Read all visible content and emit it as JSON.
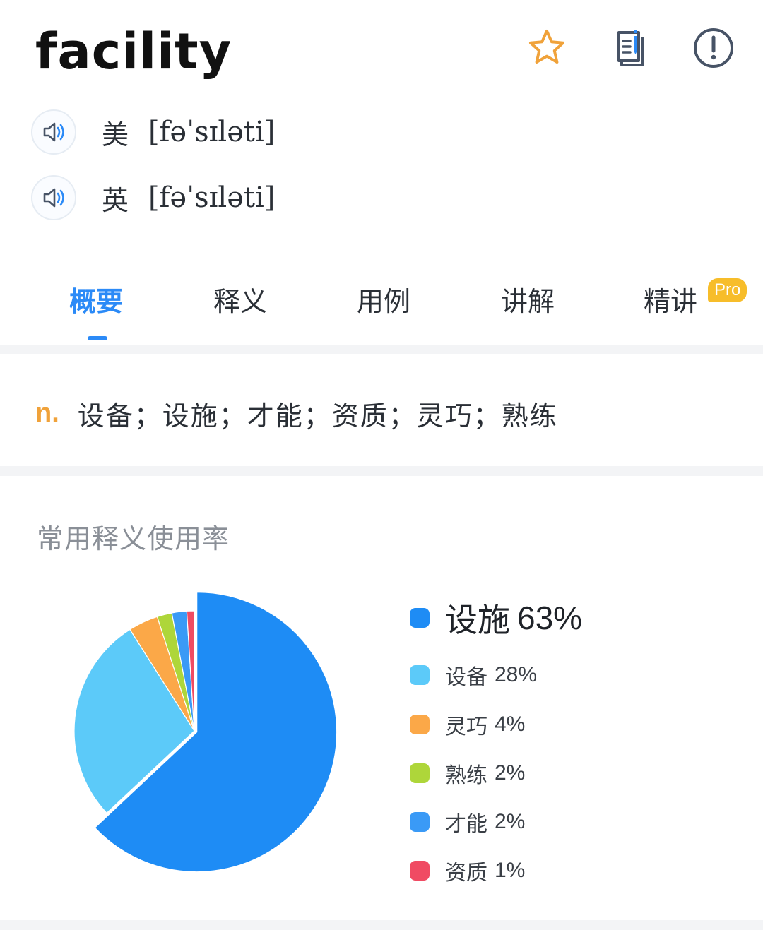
{
  "header": {
    "word": "facility",
    "icons": [
      {
        "name": "star-icon",
        "color": "#f0a23a"
      },
      {
        "name": "wordbook-icon",
        "color": "#475366"
      },
      {
        "name": "feedback-icon",
        "color": "#475366"
      }
    ]
  },
  "pronunciations": [
    {
      "region": "美",
      "ipa": "[fəˈsɪləti]"
    },
    {
      "region": "英",
      "ipa": "[fəˈsɪləti]"
    }
  ],
  "tabs": [
    {
      "label": "概要",
      "active": true
    },
    {
      "label": "释义",
      "active": false
    },
    {
      "label": "用例",
      "active": false
    },
    {
      "label": "讲解",
      "active": false
    },
    {
      "label": "精讲",
      "active": false,
      "badge": "Pro"
    }
  ],
  "definition": {
    "pos": "n.",
    "text": "设备；设施；才能；资质；灵巧；熟练"
  },
  "usage_section": {
    "title": "常用释义使用率"
  },
  "chart_data": {
    "type": "pie",
    "categories": [
      "设施",
      "设备",
      "灵巧",
      "熟练",
      "才能",
      "资质"
    ],
    "values": [
      63,
      28,
      4,
      2,
      2,
      1
    ],
    "labels": [
      "63%",
      "28%",
      "4%",
      "2%",
      "2%",
      "1%"
    ],
    "colors": [
      "#1e8cf5",
      "#5ccaf9",
      "#fba848",
      "#aed63a",
      "#3a9af6",
      "#f04b63"
    ],
    "legend": "right"
  }
}
